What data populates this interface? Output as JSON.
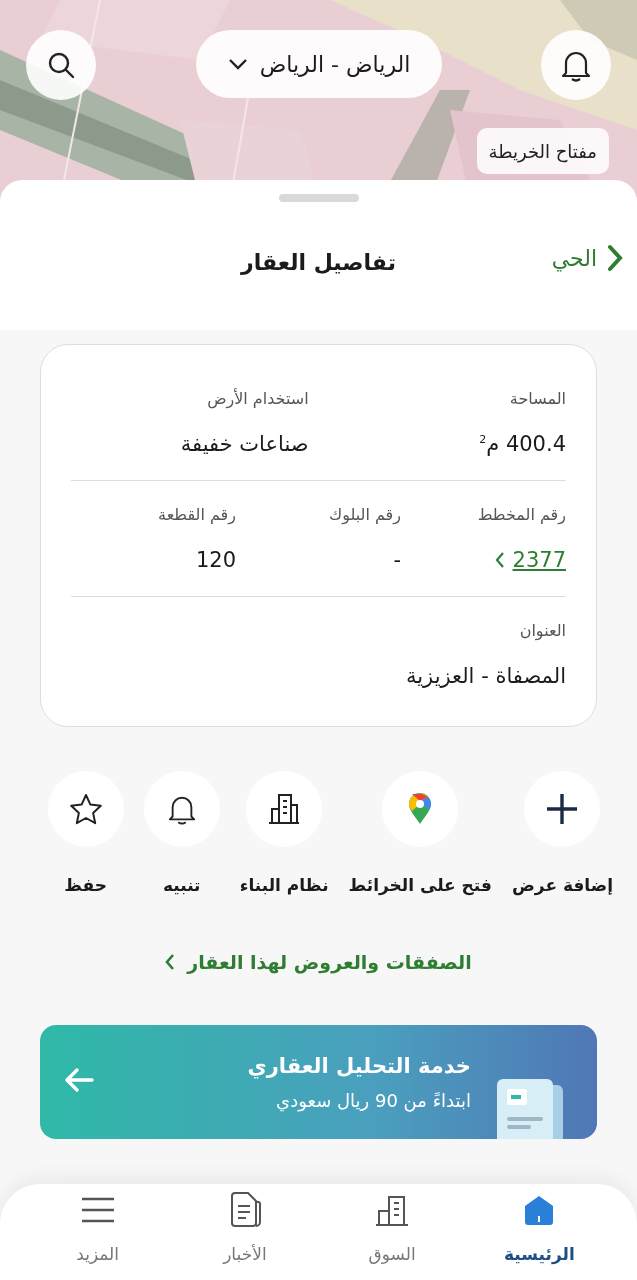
{
  "map": {
    "city_selector": "الرياض - الرياض",
    "map_key_button": "مفتاح الخريطة"
  },
  "sheet": {
    "back_link": "الحي",
    "title": "تفاصيل العقار"
  },
  "details": {
    "sections": [
      {
        "fields": [
          {
            "kind": "text",
            "label": "المساحة",
            "value": "400.4 م$^{2}$"
          },
          {
            "kind": "text",
            "label": "استخدام الأرض",
            "value": "صناعات خفيفة"
          }
        ]
      },
      {
        "fields": [
          {
            "kind": "link",
            "label": "رقم المخطط",
            "value": "2377"
          },
          {
            "kind": "text",
            "label": "رقم البلوك",
            "value": "-"
          },
          {
            "kind": "text",
            "label": "رقم القطعة",
            "value": "120"
          }
        ]
      },
      {
        "fields": [
          {
            "kind": "text",
            "label": "العنوان",
            "value": "المصفاة - العزيزية"
          }
        ]
      }
    ]
  },
  "actions": [
    {
      "label": "إضافة عرض"
    },
    {
      "label": "فتح على الخرائط"
    },
    {
      "label": "نظام البناء"
    },
    {
      "label": "تنبيه"
    },
    {
      "label": "حفظ"
    }
  ],
  "deals_link": "الصفقات والعروض لهذا العقار",
  "banner": {
    "title": "خدمة التحليل العقاري",
    "subtitle": "ابتداءً من 90 ريال سعودي"
  },
  "nav": [
    {
      "label": "الرئيسية",
      "selected": true
    },
    {
      "label": "السوق",
      "selected": false
    },
    {
      "label": "الأخبار",
      "selected": false
    },
    {
      "label": "المزيد",
      "selected": false
    }
  ]
}
